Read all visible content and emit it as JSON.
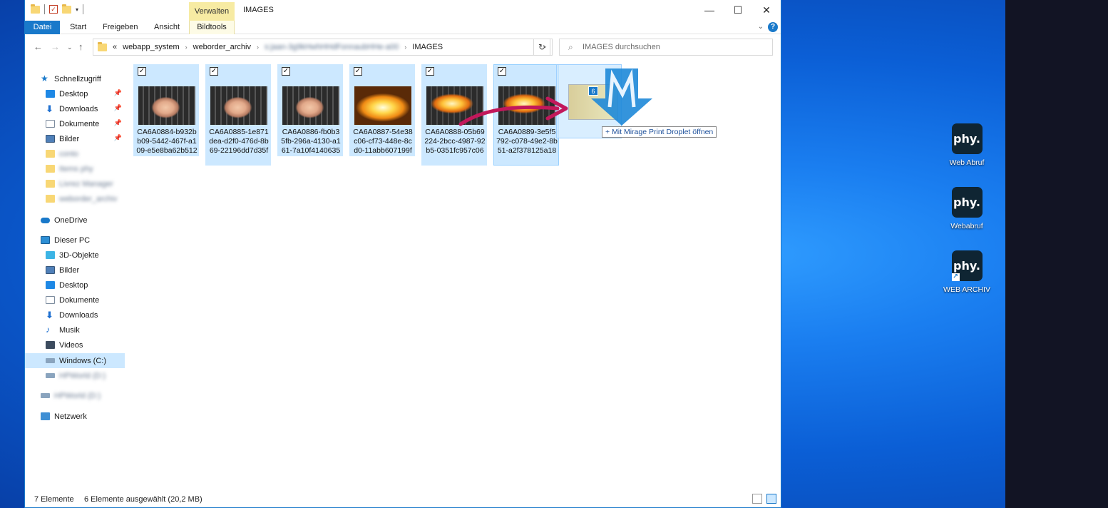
{
  "window": {
    "title": "IMAGES",
    "context_tab": "Verwalten",
    "controls": {
      "minimize": "—",
      "maximize": "☐",
      "close": "✕"
    }
  },
  "ribbon": {
    "file": "Datei",
    "tabs": [
      "Start",
      "Freigeben",
      "Ansicht",
      "Bildtools"
    ]
  },
  "address": {
    "overflow": "«",
    "crumbs": [
      "webapp_system",
      "weborder_archiv",
      "s:jaan-3g9kHwhHHdFonnaubHHe-a00",
      "IMAGES"
    ],
    "search_placeholder": "IMAGES durchsuchen"
  },
  "sidebar": {
    "quick_access": "Schnellzugriff",
    "quick_items": [
      {
        "label": "Desktop",
        "icon": "desktop-icon",
        "pinned": true
      },
      {
        "label": "Downloads",
        "icon": "download-icon",
        "pinned": true
      },
      {
        "label": "Dokumente",
        "icon": "documents-icon",
        "pinned": true
      },
      {
        "label": "Bilder",
        "icon": "pictures-icon",
        "pinned": true
      },
      {
        "label": "conto",
        "icon": "folder-icon"
      },
      {
        "label": "Items phy",
        "icon": "folder-icon"
      },
      {
        "label": "Livrez Manager",
        "icon": "folder-icon"
      },
      {
        "label": "weborder_archiv",
        "icon": "folder-icon"
      }
    ],
    "onedrive": "OneDrive",
    "this_pc": "Dieser PC",
    "pc_items": [
      {
        "label": "3D-Objekte",
        "icon": "3d-objects-icon"
      },
      {
        "label": "Bilder",
        "icon": "pictures-icon"
      },
      {
        "label": "Desktop",
        "icon": "desktop-icon"
      },
      {
        "label": "Dokumente",
        "icon": "documents-icon"
      },
      {
        "label": "Downloads",
        "icon": "download-icon"
      },
      {
        "label": "Musik",
        "icon": "music-icon"
      },
      {
        "label": "Videos",
        "icon": "video-icon"
      },
      {
        "label": "Windows (C:)",
        "icon": "drive-c-icon"
      },
      {
        "label": "HPWorld (D:)",
        "icon": "drive-icon"
      }
    ],
    "extra_drive": "HPWorld (D:)",
    "network": "Netzwerk"
  },
  "files": [
    {
      "name": "CA6A0884-b932bb09-5442-467f-a109-e5e8ba62b512",
      "thumb": "grill"
    },
    {
      "name": "CA6A0885-1e871dea-d2f0-476d-8b69-22196dd7d35f",
      "thumb": "grill"
    },
    {
      "name": "CA6A0886-fb0b35fb-296a-4130-a161-7a10f4140635",
      "thumb": "grill"
    },
    {
      "name": "CA6A0887-54e38c06-cf73-448e-8cd0-11abb607199f",
      "thumb": "fire"
    },
    {
      "name": "CA6A0888-05b69224-2bcc-4987-92b5-0351fc957c06",
      "thumb": "fire2"
    },
    {
      "name": "CA6A0889-3e5f5792-c078-49e2-8b51-a2f378125a18",
      "thumb": "fire2"
    }
  ],
  "drag": {
    "count": "6",
    "tooltip_plus": "+",
    "tooltip": "Mit Mirage Print Droplet öffnen"
  },
  "status": {
    "count": "7 Elemente",
    "selection": "6 Elemente ausgewählt (20,2 MB)"
  },
  "desktop_icons": [
    {
      "tile": "phy.",
      "label": "Web Abruf"
    },
    {
      "tile": "phy.",
      "label": "Webabruf"
    },
    {
      "tile": "phy.",
      "label": "WEB ARCHIV"
    }
  ],
  "colors": {
    "accent": "#1979ca",
    "selection": "#cce8ff",
    "context_tab": "#f7eba3"
  }
}
